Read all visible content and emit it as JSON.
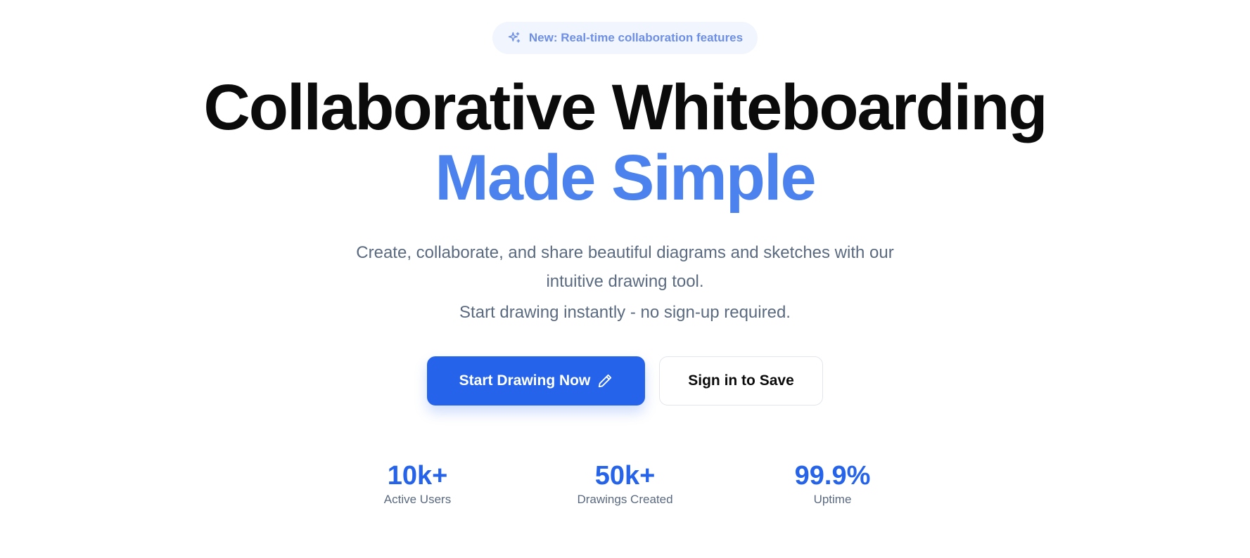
{
  "badge": {
    "icon": "sparkles-icon",
    "text": "New: Real-time collaboration features"
  },
  "headline": {
    "line1": "Collaborative Whiteboarding",
    "line2": "Made Simple"
  },
  "description": {
    "line1": "Create, collaborate, and share beautiful diagrams and sketches with our intuitive drawing tool.",
    "line2": "Start drawing instantly - no sign-up required."
  },
  "buttons": {
    "primary_label": "Start Drawing Now",
    "primary_icon": "pencil-icon",
    "secondary_label": "Sign in to Save"
  },
  "stats": [
    {
      "value": "10k+",
      "label": "Active Users"
    },
    {
      "value": "50k+",
      "label": "Drawings Created"
    },
    {
      "value": "99.9%",
      "label": "Uptime"
    }
  ],
  "colors": {
    "accent": "#2563eb",
    "headline_accent": "#4b82ee",
    "badge_bg": "#f1f5fd",
    "badge_text": "#6d8fe6",
    "muted_text": "#5a6a80"
  }
}
